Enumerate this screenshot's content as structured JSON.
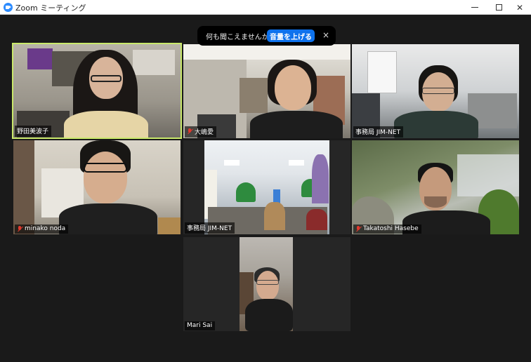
{
  "window": {
    "title": "Zoom ミーティング",
    "icon": "zoom-icon"
  },
  "banner": {
    "text": "何も聞こえませんか？",
    "button_label": "音量を上げる",
    "close": "×"
  },
  "participants": [
    {
      "name": "野田美波子",
      "muted": false,
      "active_speaker": true
    },
    {
      "name": "大嶋愛",
      "muted": true,
      "active_speaker": false
    },
    {
      "name": "事務局 JIM-NET",
      "muted": false,
      "active_speaker": false
    },
    {
      "name": "minako noda",
      "muted": true,
      "active_speaker": false
    },
    {
      "name": "事務局 JIM-NET",
      "muted": false,
      "active_speaker": false
    },
    {
      "name": "Takatoshi Hasebe",
      "muted": true,
      "active_speaker": false
    },
    {
      "name": "Mari Sai",
      "muted": false,
      "active_speaker": false
    }
  ],
  "colors": {
    "active_border": "#c9e86a",
    "accent": "#0e72ed",
    "mute": "#e0392d"
  }
}
